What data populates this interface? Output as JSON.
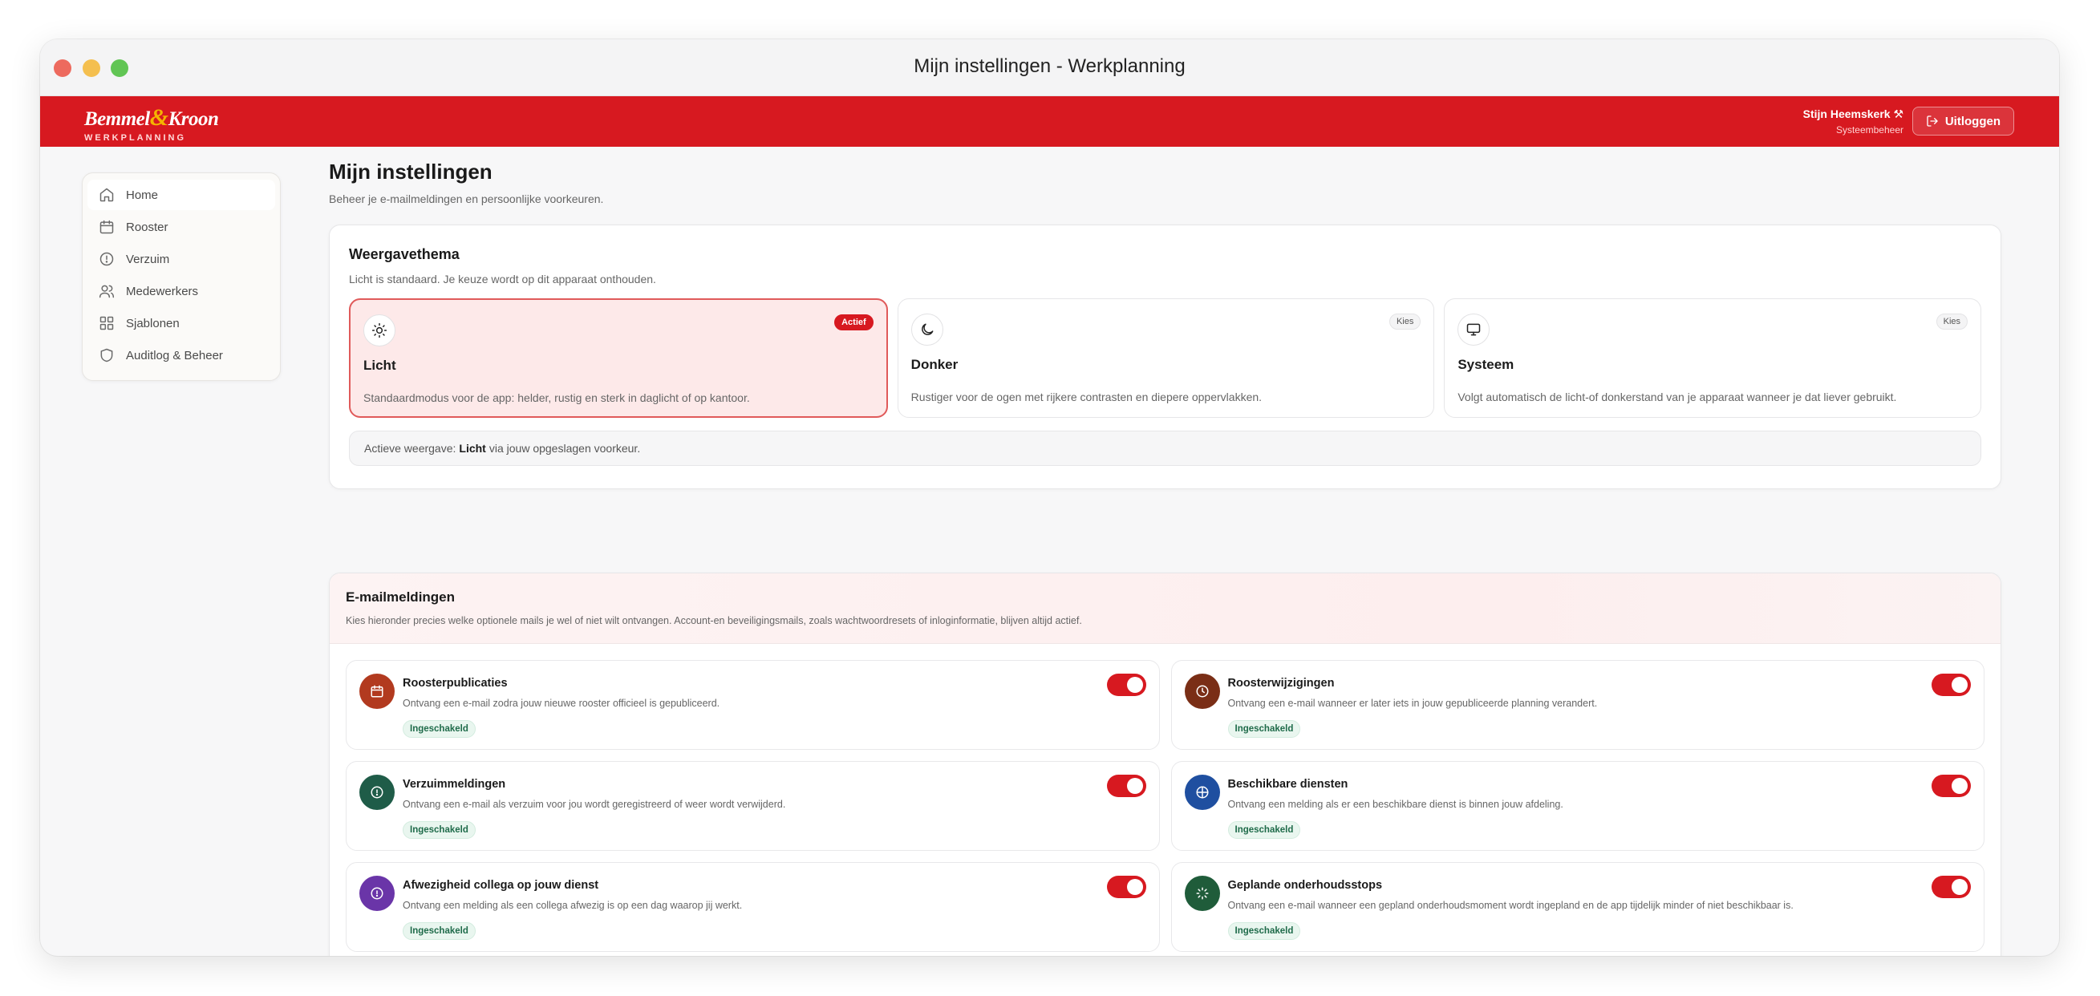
{
  "window": {
    "title": "Mijn instellingen - Werkplanning"
  },
  "brand": {
    "name_part1": "Bemmel",
    "amp": "&",
    "name_part2": "Kroon",
    "sub": "WERKPLANNING"
  },
  "user": {
    "name": "Stijn Heemskerk ⚒",
    "role": "Systeembeheer",
    "logout_label": "Uitloggen"
  },
  "colors": {
    "brand_red": "#d71920",
    "status_green": "#1f6b4a"
  },
  "sidebar": {
    "items": [
      {
        "label": "Home",
        "icon": "home-icon"
      },
      {
        "label": "Rooster",
        "icon": "calendar-icon"
      },
      {
        "label": "Verzuim",
        "icon": "alert-circle-icon"
      },
      {
        "label": "Medewerkers",
        "icon": "users-icon"
      },
      {
        "label": "Sjablonen",
        "icon": "grid-icon"
      },
      {
        "label": "Auditlog & Beheer",
        "icon": "shield-icon"
      }
    ]
  },
  "page": {
    "title": "Mijn instellingen",
    "subtitle": "Beheer je e-mailmeldingen en persoonlijke voorkeuren."
  },
  "theme": {
    "title": "Weergavethema",
    "subtitle": "Licht is standaard. Je keuze wordt op dit apparaat onthouden.",
    "options": [
      {
        "name": "Licht",
        "desc": "Standaardmodus voor de app: helder, rustig en sterk in daglicht of op kantoor.",
        "badge": "Actief",
        "icon": "sun-icon",
        "selected": true
      },
      {
        "name": "Donker",
        "desc": "Rustiger voor de ogen met rijkere contrasten en diepere oppervlakken.",
        "badge": "Kies",
        "icon": "moon-icon",
        "selected": false
      },
      {
        "name": "Systeem",
        "desc": "Volgt automatisch de licht-of donkerstand van je apparaat wanneer je dat liever gebruikt.",
        "badge": "Kies",
        "icon": "monitor-icon",
        "selected": false
      }
    ],
    "active_prefix": "Actieve weergave:",
    "active_value": "Licht",
    "active_suffix": "via jouw opgeslagen voorkeur."
  },
  "email": {
    "title": "E-mailmeldingen",
    "subtitle": "Kies hieronder precies welke optionele mails je wel of niet wilt ontvangen. Account-en beveiligingsmails, zoals wachtwoordresets of inloginformatie, blijven altijd actief.",
    "items": [
      {
        "title": "Roosterpublicaties",
        "desc": "Ontvang een e-mail zodra jouw nieuwe rooster officieel is gepubliceerd.",
        "status": "Ingeschakeld",
        "icon": "calendar-icon",
        "color": "#b23a1f",
        "enabled": true
      },
      {
        "title": "Roosterwijzigingen",
        "desc": "Ontvang een e-mail wanneer er later iets in jouw gepubliceerde planning verandert.",
        "status": "Ingeschakeld",
        "icon": "clock-icon",
        "color": "#7a2e16",
        "enabled": true
      },
      {
        "title": "Verzuimmeldingen",
        "desc": "Ontvang een e-mail als verzuim voor jou wordt geregistreerd of weer wordt verwijderd.",
        "status": "Ingeschakeld",
        "icon": "alert-circle-icon",
        "color": "#1f5c48",
        "enabled": true
      },
      {
        "title": "Beschikbare diensten",
        "desc": "Ontvang een melding als er een beschikbare dienst is binnen jouw afdeling.",
        "status": "Ingeschakeld",
        "icon": "crosshair-icon",
        "color": "#1f4fa0",
        "enabled": true
      },
      {
        "title": "Afwezigheid collega op jouw dienst",
        "desc": "Ontvang een melding als een collega afwezig is op een dag waarop jij werkt.",
        "status": "Ingeschakeld",
        "icon": "alert-circle-icon",
        "color": "#6a35a8",
        "enabled": true
      },
      {
        "title": "Geplande onderhoudsstops",
        "desc": "Ontvang een e-mail wanneer een gepland onderhoudsmoment wordt ingepland en de app tijdelijk minder of niet beschikbaar is.",
        "status": "Ingeschakeld",
        "icon": "loader-icon",
        "color": "#1f5c3a",
        "enabled": true
      }
    ]
  }
}
